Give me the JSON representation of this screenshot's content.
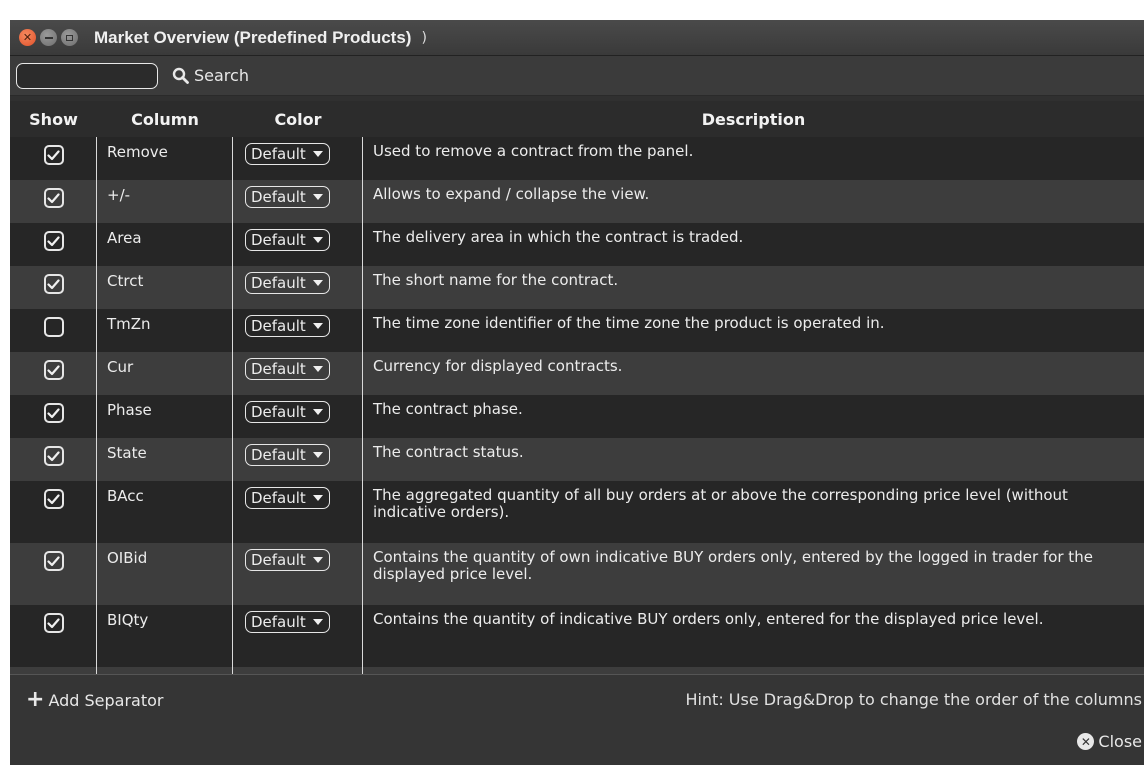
{
  "window": {
    "title": "Market Overview (Predefined Products)",
    "title_tail": ")"
  },
  "search": {
    "value": "",
    "placeholder": "",
    "button_label": "Search"
  },
  "table": {
    "headers": {
      "show": "Show",
      "column": "Column",
      "color": "Color",
      "description": "Description"
    },
    "rows": [
      {
        "checked": true,
        "column": "Remove",
        "color": "Default",
        "description": "Used to remove a contract from the panel."
      },
      {
        "checked": true,
        "column": "+/-",
        "color": "Default",
        "description": "Allows to expand / collapse the view."
      },
      {
        "checked": true,
        "column": "Area",
        "color": "Default",
        "description": "The delivery area in which the contract is traded."
      },
      {
        "checked": true,
        "column": "Ctrct",
        "color": "Default",
        "description": "The short name for the contract."
      },
      {
        "checked": false,
        "column": "TmZn",
        "color": "Default",
        "description": "The time zone identifier of the time zone the product is operated in."
      },
      {
        "checked": true,
        "column": "Cur",
        "color": "Default",
        "description": "Currency for displayed contracts."
      },
      {
        "checked": true,
        "column": "Phase",
        "color": "Default",
        "description": "The contract phase."
      },
      {
        "checked": true,
        "column": "State",
        "color": "Default",
        "description": "The contract status."
      },
      {
        "checked": true,
        "column": "BAcc",
        "color": "Default",
        "description": "The aggregated quantity of all buy orders at or above the corresponding price level (without indicative orders)."
      },
      {
        "checked": true,
        "column": "OIBid",
        "color": "Default",
        "description": "Contains the quantity of own indicative BUY orders only, entered by the logged in trader for the displayed price level."
      },
      {
        "checked": true,
        "column": "BIQty",
        "color": "Default",
        "description": "Contains the quantity of indicative BUY orders only, entered for the displayed price level."
      }
    ]
  },
  "footer": {
    "add_separator_label": "Add Separator",
    "hint": "Hint: Use Drag&Drop to change the order of the columns",
    "close_label": "Close"
  },
  "colors": {
    "background": "#303030",
    "row_dark": "#262626",
    "row_light": "#3d3d3d",
    "close_button": "#e0502a"
  },
  "icons": {
    "window_close": "close-icon",
    "window_minimize": "minimize-icon",
    "window_maximize": "maximize-icon",
    "search": "search-icon",
    "checkbox": "checkbox-icon",
    "add": "plus-icon",
    "close": "close-circle-icon"
  }
}
